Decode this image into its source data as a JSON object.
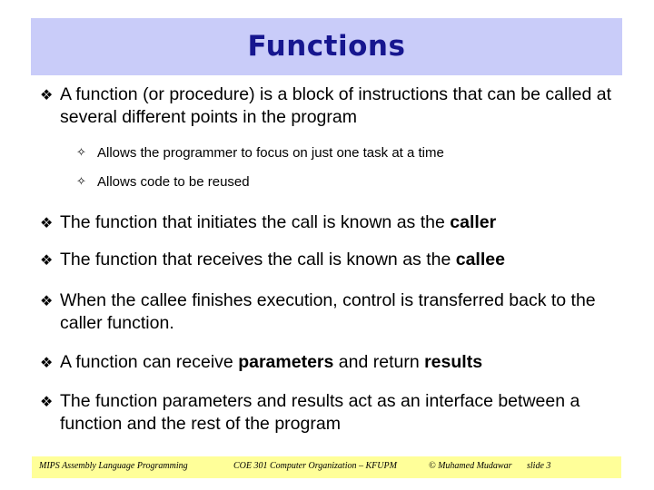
{
  "slide": {
    "title": "Functions",
    "title_color": "#16168f",
    "banner_color": "#c9ccf9",
    "background_color": "#ffffff",
    "body_text_color": "#000000"
  },
  "bullet_glyphs": {
    "level1": "❖",
    "level2": "✧",
    "level1_name": "diamond-bullet-icon",
    "level2_name": "hollow-star-bullet-icon"
  },
  "content": [
    {
      "level": 1,
      "spacing": "sp-b1",
      "parts": [
        {
          "text": "A function (or procedure) is a block of instructions that can be called at several different points in the program",
          "bold": false
        }
      ]
    },
    {
      "level": 2,
      "spacing": "sp-s1",
      "parts": [
        {
          "text": "Allows the programmer to focus on just one task at a time",
          "bold": false
        }
      ]
    },
    {
      "level": 2,
      "spacing": "sp-s2",
      "parts": [
        {
          "text": "Allows code to be reused",
          "bold": false
        }
      ]
    },
    {
      "level": 1,
      "spacing": "sp-b2",
      "parts": [
        {
          "text": "The function that initiates the call is known as the ",
          "bold": false
        },
        {
          "text": "caller",
          "bold": true
        }
      ]
    },
    {
      "level": 1,
      "spacing": "sp-b3",
      "parts": [
        {
          "text": "The function that receives the call is known as the ",
          "bold": false
        },
        {
          "text": "callee",
          "bold": true
        }
      ]
    },
    {
      "level": 1,
      "spacing": "sp-b4",
      "parts": [
        {
          "text": "When the callee finishes execution, control is transferred back to the caller function.",
          "bold": false
        }
      ]
    },
    {
      "level": 1,
      "spacing": "sp-b5",
      "parts": [
        {
          "text": "A function can receive ",
          "bold": false
        },
        {
          "text": "parameters",
          "bold": true
        },
        {
          "text": " and return ",
          "bold": false
        },
        {
          "text": "results",
          "bold": true
        }
      ]
    },
    {
      "level": 1,
      "spacing": "sp-b6",
      "parts": [
        {
          "text": "The function parameters and results act as an interface between a function and the rest of the program",
          "bold": false
        }
      ]
    }
  ],
  "footer": {
    "background_color": "#ffff99",
    "left": "MIPS Assembly Language Programming",
    "center": "COE 301 Computer Organization – KFUPM",
    "copyright": "© Muhamed Mudawar",
    "slide_number": "slide 3"
  }
}
